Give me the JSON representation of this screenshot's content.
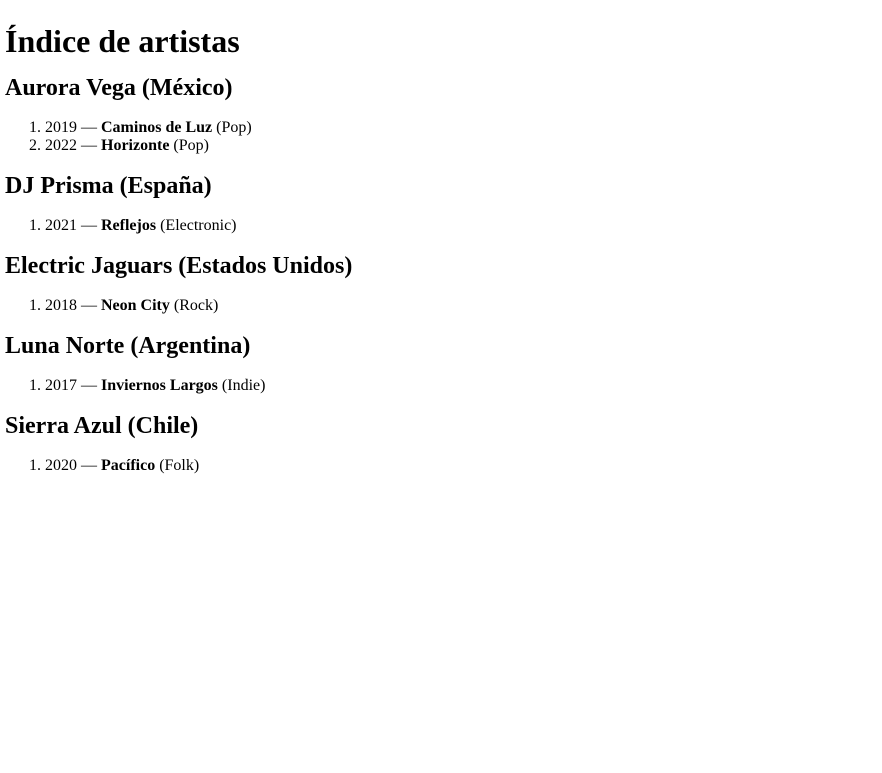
{
  "page_title": "Índice de artistas",
  "artists": [
    {
      "heading": "Aurora Vega (México)",
      "albums": [
        {
          "year": "2019",
          "title": "Caminos de Luz",
          "genre": "(Pop)"
        },
        {
          "year": "2022",
          "title": "Horizonte",
          "genre": "(Pop)"
        }
      ]
    },
    {
      "heading": "DJ Prisma (España)",
      "albums": [
        {
          "year": "2021",
          "title": "Reflejos",
          "genre": "(Electronic)"
        }
      ]
    },
    {
      "heading": "Electric Jaguars (Estados Unidos)",
      "albums": [
        {
          "year": "2018",
          "title": "Neon City",
          "genre": "(Rock)"
        }
      ]
    },
    {
      "heading": "Luna Norte (Argentina)",
      "albums": [
        {
          "year": "2017",
          "title": "Inviernos Largos",
          "genre": "(Indie)"
        }
      ]
    },
    {
      "heading": "Sierra Azul (Chile)",
      "albums": [
        {
          "year": "2020",
          "title": "Pacífico",
          "genre": "(Folk)"
        }
      ]
    }
  ],
  "separator": "—"
}
